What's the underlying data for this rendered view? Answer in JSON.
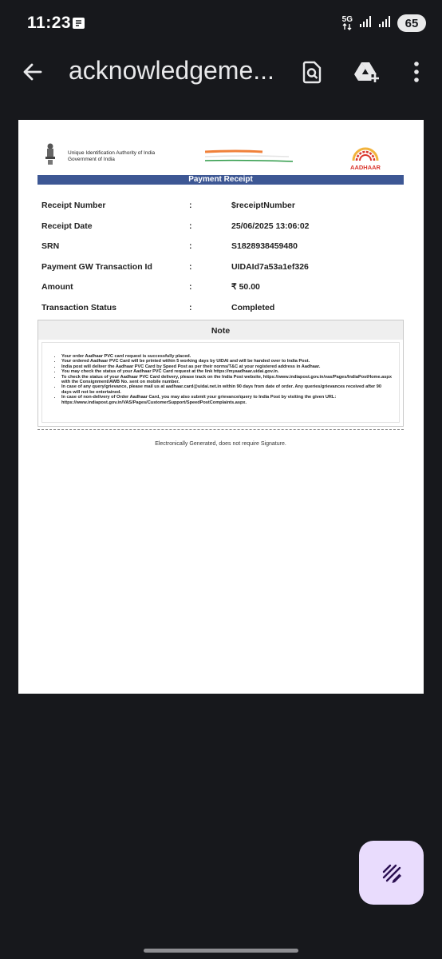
{
  "status_bar": {
    "time": "11:23",
    "network": "5G",
    "battery": "65",
    "icons": [
      "notification-icon",
      "data-arrows-icon",
      "signal-icon",
      "signal-icon",
      "battery-icon"
    ]
  },
  "app_bar": {
    "title": "acknowledgeme...",
    "icons": [
      "back-arrow-icon",
      "find-in-page-icon",
      "drive-add-icon",
      "more-vert-icon"
    ]
  },
  "document": {
    "org_name": "Unique Identification Authority of India",
    "org_sub": "Government of India",
    "logo_text": "AADHAAR",
    "banner": "Payment Receipt",
    "fields": [
      {
        "label": "Receipt Number",
        "value": "$receiptNumber"
      },
      {
        "label": "Receipt Date",
        "value": "25/06/2025 13:06:02"
      },
      {
        "label": "SRN",
        "value": "S1828938459480"
      },
      {
        "label": "Payment GW Transaction Id",
        "value": "UIDAId7a53a1ef326"
      },
      {
        "label": "Amount",
        "value": "₹ 50.00"
      },
      {
        "label": "Transaction Status",
        "value": "Completed"
      }
    ],
    "colon": ":",
    "note_title": "Note",
    "notes": [
      "Your order Aadhaar PVC card request is successfully placed.",
      "Your ordered Aadhaar PVC Card will be printed within 5 working days by UIDAI and will be handed over to India Post.",
      "India post will deliver the Aadhaar PVC Card by Speed Post as per their norms/T&C at your registered address in Aadhaar.",
      "You may check the status of your Aadhaar PVC Card request at the link https://myaadhaar.uidai.gov.in.",
      "To check the status of your Aadhaar PVC Card delivery, please track on the India Post website, https://www.indiapost.gov.in/vas/Pages/IndiaPostHome.aspx with the Consignment/AWB No. sent on mobile number.",
      "In case of any query/grievance, please mail us at aadhaar.card@uidai.net.in within 90 days from date of order. Any queries/grievances received after 90 days will not be entertained.",
      "In case of non-delivery of Order Aadhaar Card, you may also submit your grievance/query to India Post by visiting the given URL: https://www.indiapost.gov.in/VAS/Pages/CustomerSupport/SpeedPostComplaints.aspx."
    ],
    "footer": "Electronically Generated, does not require Signature."
  },
  "fab": {
    "icon": "edit-ink-icon"
  },
  "colors": {
    "background": "#17181c",
    "banner_blue": "#3d5794",
    "fab_bg": "#e9dcfd",
    "flag_saffron": "#f0813a",
    "flag_green": "#2e9a48"
  }
}
